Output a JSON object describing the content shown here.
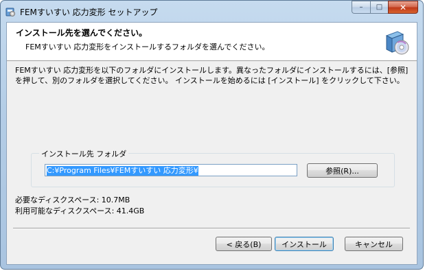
{
  "window": {
    "title": "FEMすいすい 応力変形 セットアップ",
    "controls": {
      "minimize": "–",
      "maximize": "□",
      "close": "✕"
    }
  },
  "header": {
    "title": "インストール先を選んでください。",
    "subtitle": "FEMすいすい 応力変形をインストールするフォルダを選んでください。",
    "icon": "installer-cd-icon"
  },
  "description": "FEMすいすい 応力変形を以下のフォルダにインストールします。異なったフォルダにインストールするには、[参照] を押して、別のフォルダを選択してください。 インストールを始めるには [インストール] をクリックして下さい。",
  "destination": {
    "group_label": "インストール先 フォルダ",
    "path_value": "C:¥Program Files¥FEMすいすい 応力変形¥",
    "browse_label": "参照(R)..."
  },
  "space": {
    "required": "必要なディスクスペース: 10.7MB",
    "available": "利用可能なディスクスペース: 41.4GB"
  },
  "footer": {
    "back_label": "< 戻る(B)",
    "install_label": "インストール",
    "cancel_label": "キャンセル"
  }
}
